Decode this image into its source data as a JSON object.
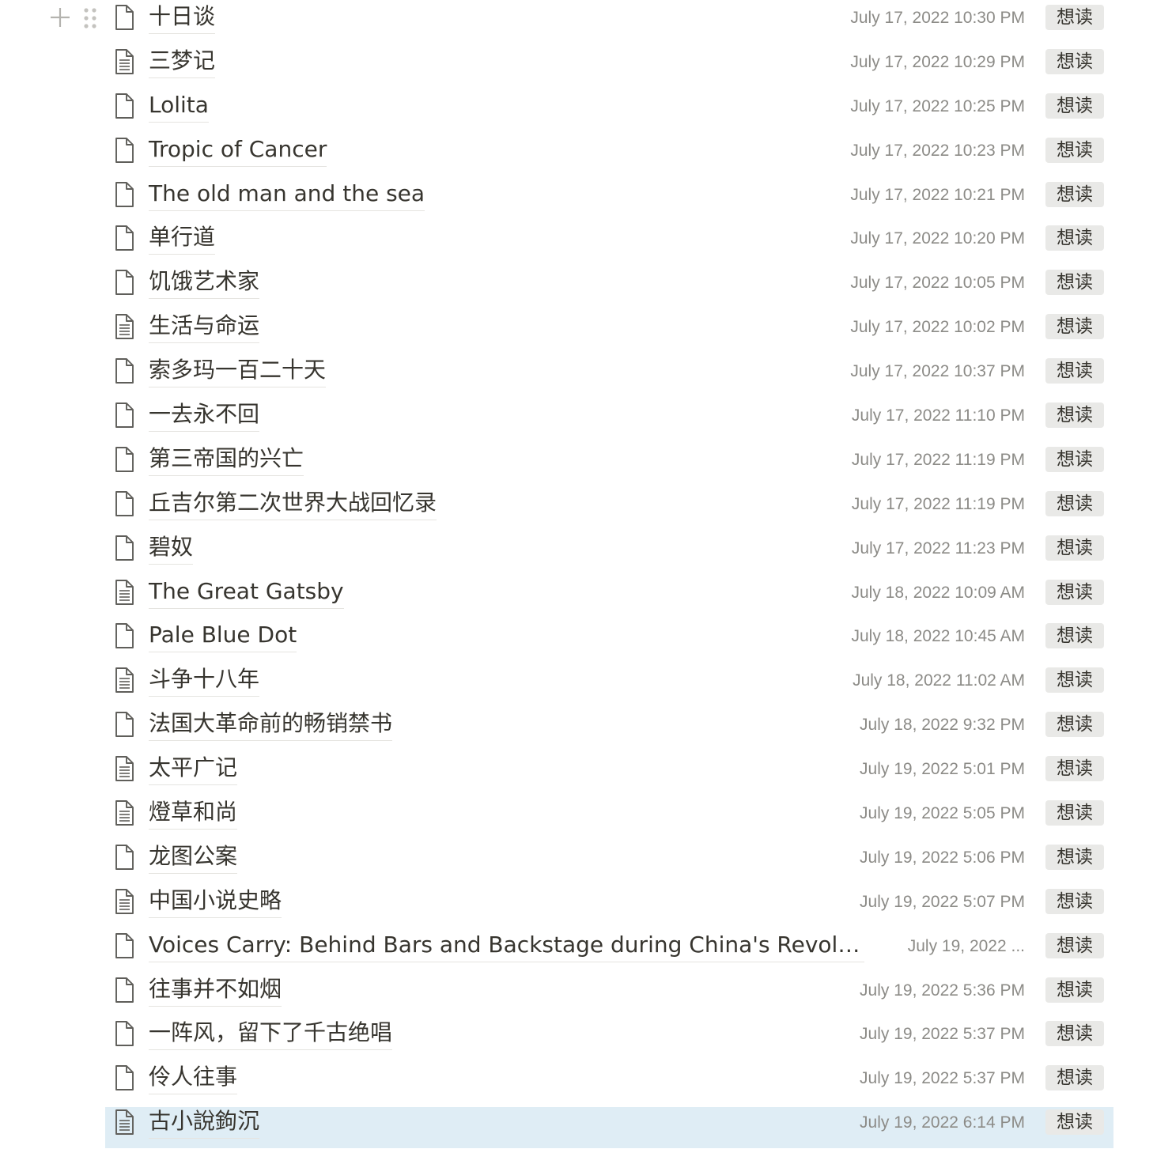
{
  "icons": {
    "add": "plus-icon",
    "drag": "drag-handle-icon",
    "page": "page-icon",
    "page_with_content": "page-text-icon"
  },
  "colors": {
    "selected_row": "#dfedf5",
    "tag_background": "#e9e9e7",
    "date_text": "#8c8b87"
  },
  "rows": [
    {
      "title": "十日谈",
      "date": "July 17, 2022 10:30 PM",
      "tag": "想读",
      "icon": "page-icon"
    },
    {
      "title": "三梦记",
      "date": "July 17, 2022 10:29 PM",
      "tag": "想读",
      "icon": "page-text-icon"
    },
    {
      "title": "Lolita",
      "date": "July 17, 2022 10:25 PM",
      "tag": "想读",
      "icon": "page-icon"
    },
    {
      "title": "Tropic of Cancer",
      "date": "July 17, 2022 10:23 PM",
      "tag": "想读",
      "icon": "page-icon"
    },
    {
      "title": "The old man and the sea",
      "date": "July 17, 2022 10:21 PM",
      "tag": "想读",
      "icon": "page-icon"
    },
    {
      "title": "单行道",
      "date": "July 17, 2022 10:20 PM",
      "tag": "想读",
      "icon": "page-icon"
    },
    {
      "title": "饥饿艺术家",
      "date": "July 17, 2022 10:05 PM",
      "tag": "想读",
      "icon": "page-icon"
    },
    {
      "title": "生活与命运",
      "date": "July 17, 2022 10:02 PM",
      "tag": "想读",
      "icon": "page-text-icon"
    },
    {
      "title": "索多玛一百二十天",
      "date": "July 17, 2022 10:37 PM",
      "tag": "想读",
      "icon": "page-icon"
    },
    {
      "title": "一去永不回",
      "date": "July 17, 2022 11:10 PM",
      "tag": "想读",
      "icon": "page-icon"
    },
    {
      "title": "第三帝国的兴亡",
      "date": "July 17, 2022 11:19 PM",
      "tag": "想读",
      "icon": "page-icon"
    },
    {
      "title": "丘吉尔第二次世界大战回忆录",
      "date": "July 17, 2022 11:19 PM",
      "tag": "想读",
      "icon": "page-icon"
    },
    {
      "title": "碧奴",
      "date": "July 17, 2022 11:23 PM",
      "tag": "想读",
      "icon": "page-icon"
    },
    {
      "title": "The Great Gatsby",
      "date": "July 18, 2022 10:09 AM",
      "tag": "想读",
      "icon": "page-text-icon"
    },
    {
      "title": "Pale Blue Dot",
      "date": "July 18, 2022 10:45 AM",
      "tag": "想读",
      "icon": "page-icon"
    },
    {
      "title": "斗争十八年",
      "date": "July 18, 2022 11:02 AM",
      "tag": "想读",
      "icon": "page-text-icon"
    },
    {
      "title": "法国大革命前的畅销禁书",
      "date": "July 18, 2022 9:32 PM",
      "tag": "想读",
      "icon": "page-icon"
    },
    {
      "title": "太平广记",
      "date": "July 19, 2022 5:01 PM",
      "tag": "想读",
      "icon": "page-text-icon"
    },
    {
      "title": "燈草和尚",
      "date": "July 19, 2022 5:05 PM",
      "tag": "想读",
      "icon": "page-text-icon"
    },
    {
      "title": "龙图公案",
      "date": "July 19, 2022 5:06 PM",
      "tag": "想读",
      "icon": "page-icon"
    },
    {
      "title": "中国小说史略",
      "date": "July 19, 2022 5:07 PM",
      "tag": "想读",
      "icon": "page-text-icon"
    },
    {
      "title": "Voices Carry: Behind Bars and Backstage during China's Revoluti...",
      "date": "July 19, 2022 ...",
      "tag": "想读",
      "icon": "page-icon"
    },
    {
      "title": "往事并不如烟",
      "date": "July 19, 2022 5:36 PM",
      "tag": "想读",
      "icon": "page-icon"
    },
    {
      "title": "一阵风，留下了千古绝唱",
      "date": "July 19, 2022 5:37 PM",
      "tag": "想读",
      "icon": "page-icon"
    },
    {
      "title": "伶人往事",
      "date": "July 19, 2022 5:37 PM",
      "tag": "想读",
      "icon": "page-icon"
    },
    {
      "title": "古小說鉤沉",
      "date": "July 19, 2022 6:14 PM",
      "tag": "想读",
      "icon": "page-text-icon",
      "selected": true
    }
  ]
}
